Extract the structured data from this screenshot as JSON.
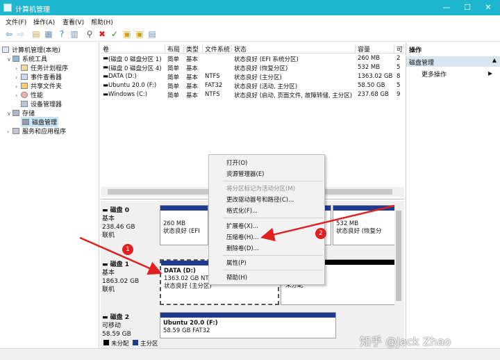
{
  "window": {
    "title": "计算机管理",
    "controls": [
      "—",
      "☐",
      "✕"
    ]
  },
  "menu": [
    "文件(F)",
    "操作(A)",
    "查看(V)",
    "帮助(H)"
  ],
  "tree": {
    "root": "计算机管理(本地)",
    "system_tools": "系统工具",
    "task_scheduler": "任务计划程序",
    "event_viewer": "事件查看器",
    "shared_folders": "共享文件夹",
    "performance": "性能",
    "device_manager": "设备管理器",
    "storage": "存储",
    "disk_management": "磁盘管理",
    "services": "服务和应用程序"
  },
  "volumes": {
    "headers": [
      "卷",
      "布局",
      "类型",
      "文件系统",
      "状态",
      "容量",
      "可"
    ],
    "rows": [
      [
        "(磁盘 0 磁盘分区 1)",
        "简单",
        "基本",
        "",
        "状态良好 (EFI 系统分区)",
        "260 MB",
        "2"
      ],
      [
        "(磁盘 0 磁盘分区 4)",
        "简单",
        "基本",
        "",
        "状态良好 (恢复分区)",
        "532 MB",
        "5"
      ],
      [
        "DATA (D:)",
        "简单",
        "基本",
        "NTFS",
        "状态良好 (主分区)",
        "1363.02 GB",
        "8"
      ],
      [
        "Ubuntu 20.0 (F:)",
        "简单",
        "基本",
        "FAT32",
        "状态良好 (活动, 主分区)",
        "58.50 GB",
        "5"
      ],
      [
        "Windows (C:)",
        "简单",
        "基本",
        "NTFS",
        "状态良好 (启动, 页面文件, 故障转储, 主分区)",
        "237.68 GB",
        "9"
      ]
    ]
  },
  "disks": [
    {
      "name": "磁盘 0",
      "type": "基本",
      "size": "238.46 GB",
      "status": "联机"
    },
    {
      "name": "磁盘 1",
      "type": "基本",
      "size": "1863.02 GB",
      "status": "联机"
    },
    {
      "name": "磁盘 2",
      "type": "可移动",
      "size": "58.59 GB",
      "status": "联机"
    }
  ],
  "partitions": {
    "efi_size": "260 MB",
    "efi_status": "状态良好 (EFI",
    "recovery_size": "532 MB",
    "recovery_status": "状态良好 (恢复分",
    "data_name": "DATA  (D:)",
    "data_size": "1363.02 GB NTFS",
    "data_status": "状态良好 (主分区)",
    "unallocated": "未分配",
    "ubuntu_name": "Ubuntu 20.0  (F:)",
    "ubuntu_size": "58.59 GB FAT32"
  },
  "legend": {
    "unallocated": "未分配",
    "primary": "主分区"
  },
  "actions": {
    "header": "操作",
    "section": "磁盘管理",
    "more": "更多操作"
  },
  "context_menu": {
    "open": "打开(O)",
    "explorer": "资源管理器(E)",
    "mark_active": "将分区标记为活动分区(M)",
    "change_letter": "更改驱动器号和路径(C)...",
    "format": "格式化(F)...",
    "extend": "扩展卷(X)...",
    "shrink": "压缩卷(H)...",
    "delete": "删除卷(D)...",
    "properties": "属性(P)",
    "help": "帮助(H)"
  },
  "annotations": {
    "badge1": "1",
    "badge2": "2"
  },
  "watermark": "知乎 @Jack Zhao",
  "colors": {
    "titlebar": "#1fb6d0",
    "primary_partition": "#1f3b8f",
    "unallocated": "#000000",
    "annotation": "#e02020"
  }
}
